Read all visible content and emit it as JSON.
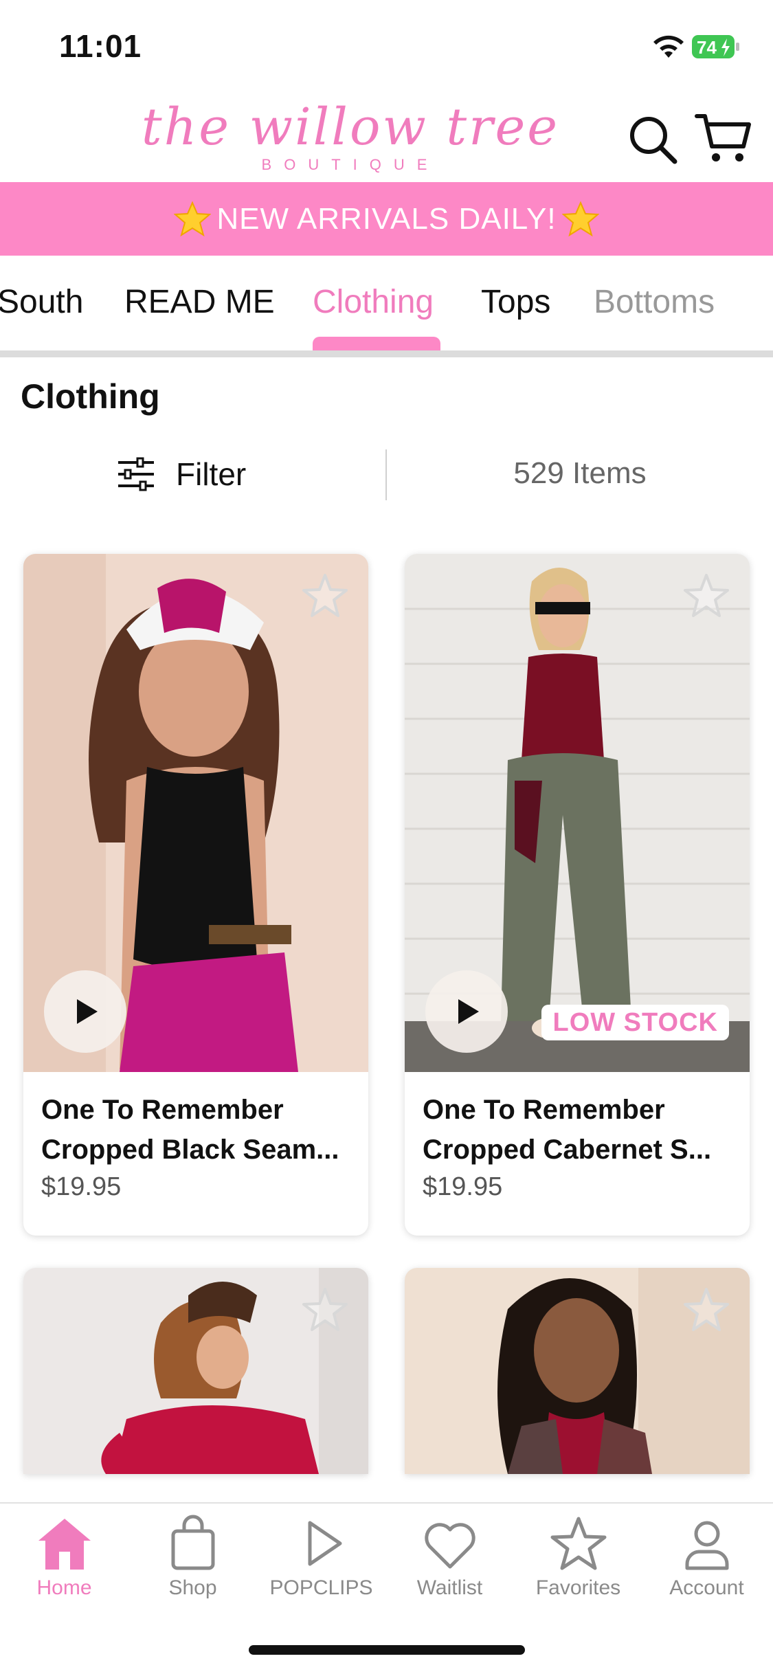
{
  "status_bar": {
    "time": "11:01",
    "battery": "74"
  },
  "header": {
    "logo_text": "the willow tree",
    "logo_subtext": "BOUTIQUE",
    "search_icon": "search-icon",
    "cart_icon": "cart-icon",
    "brand_color": "#f07cbd"
  },
  "banner": {
    "text": "NEW ARRIVALS DAILY!",
    "icon": "star-emoji",
    "color": "#fd88c6"
  },
  "category_tabs": [
    {
      "label": "South"
    },
    {
      "label": "READ ME"
    },
    {
      "label": "Clothing",
      "active": true
    },
    {
      "label": "Tops"
    },
    {
      "label": "Bottoms"
    }
  ],
  "page": {
    "title": "Clothing",
    "filter_label": "Filter",
    "items_count": "529 Items"
  },
  "products": [
    {
      "name_line1": "One To Remember",
      "name_line2": "Cropped Black Seam...",
      "price": "$19.95",
      "has_video": true,
      "badge": ""
    },
    {
      "name_line1": "One To Remember",
      "name_line2": "Cropped Cabernet S...",
      "price": "$19.95",
      "has_video": true,
      "badge": "LOW STOCK"
    },
    {
      "name_line1": "",
      "name_line2": "",
      "price": "",
      "has_video": false,
      "badge": ""
    },
    {
      "name_line1": "",
      "name_line2": "",
      "price": "",
      "has_video": false,
      "badge": ""
    }
  ],
  "bottom_nav": [
    {
      "label": "Home",
      "icon": "home-icon",
      "active": true
    },
    {
      "label": "Shop",
      "icon": "shopping-bag-icon"
    },
    {
      "label": "POPCLIPS",
      "icon": "play-icon"
    },
    {
      "label": "Waitlist",
      "icon": "heart-icon"
    },
    {
      "label": "Favorites",
      "icon": "star-icon"
    },
    {
      "label": "Account",
      "icon": "person-icon"
    }
  ]
}
